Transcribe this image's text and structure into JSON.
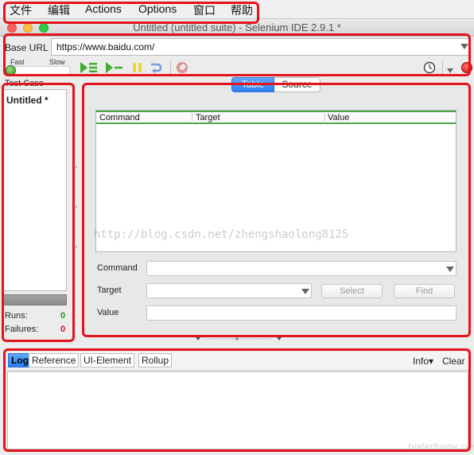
{
  "menubar": {
    "items": [
      "文件",
      "编辑",
      "Actions",
      "Options",
      "窗口",
      "帮助"
    ]
  },
  "window": {
    "title": "Untitled (untitled suite) - Selenium IDE 2.9.1 *"
  },
  "base_url": {
    "label": "Base URL",
    "value": "https://www.baidu.com/"
  },
  "toolbar": {
    "speed_fast_label": "Fast",
    "speed_slow_label": "Slow",
    "icons": [
      "play-suite-icon",
      "play-test-icon",
      "pause-icon",
      "step-icon",
      "rollup-icon",
      "schedule-icon",
      "record-icon"
    ]
  },
  "test_case_panel": {
    "header": "Test Case",
    "items": [
      "Untitled *"
    ],
    "runs_label": "Runs:",
    "runs_value": "0",
    "failures_label": "Failures:",
    "failures_value": "0"
  },
  "editor": {
    "tabs": [
      "Table",
      "Source"
    ],
    "active_tab": "Table",
    "columns": [
      "Command",
      "Target",
      "Value"
    ],
    "command_label": "Command",
    "target_label": "Target",
    "value_label": "Value",
    "select_button": "Select",
    "find_button": "Find"
  },
  "watermark": "http://blog.csdn.net/zhengshaolong8125",
  "bottom_panel": {
    "tabs": [
      "Log",
      "Reference",
      "UI-Element",
      "Rollup"
    ],
    "active_tab": "Log",
    "info_label": "Info▾",
    "clear_label": "Clear"
  },
  "corner_mark": "testerhome.com",
  "colors": {
    "highlight_border": "#e3141c",
    "active_tab": "#2a7ff4",
    "runs_value": "#1a9a1a",
    "failures_value": "#d61313"
  }
}
